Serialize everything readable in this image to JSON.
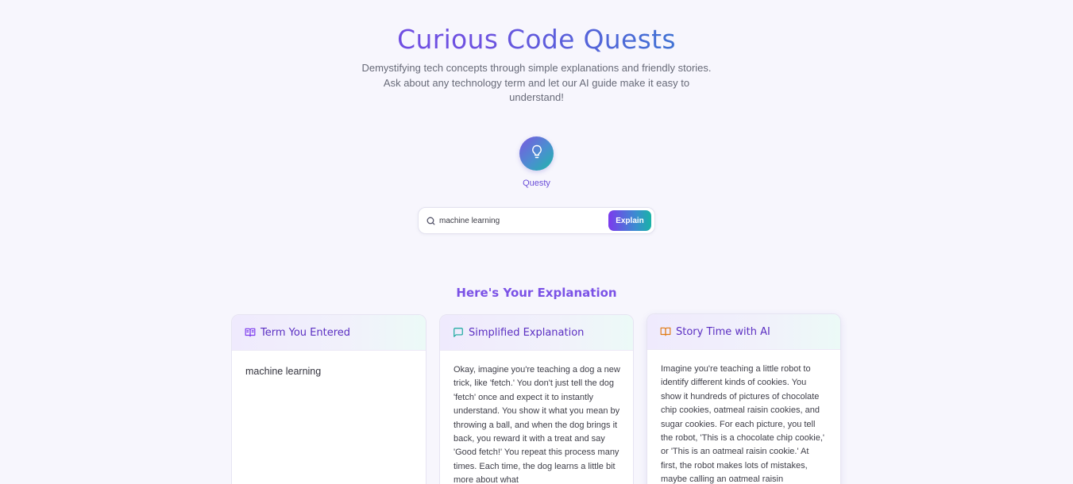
{
  "header": {
    "title": "Curious Code Quests",
    "subtitle": "Demystifying tech concepts through simple explanations and friendly stories. Ask about any technology term and let our AI guide make it easy to understand!"
  },
  "assistant": {
    "name": "Questy",
    "icon": "lightbulb-icon"
  },
  "search": {
    "value": "machine learning",
    "placeholder": "",
    "button_label": "Explain"
  },
  "results": {
    "heading": "Here's Your Explanation",
    "cards": [
      {
        "title": "Term You Entered",
        "icon": "book-open-icon",
        "text": "machine learning"
      },
      {
        "title": "Simplified Explanation",
        "icon": "message-square-icon",
        "text": "Okay, imagine you're teaching a dog a new trick, like 'fetch.' You don't just tell the dog 'fetch' once and expect it to instantly understand. You show it what you mean by throwing a ball, and when the dog brings it back, you reward it with a treat and say 'Good fetch!' You repeat this process many times. Each time, the dog learns a little bit more about what"
      },
      {
        "title": "Story Time with AI",
        "icon": "book-icon",
        "text": "Imagine you're teaching a little robot to identify different kinds of cookies. You show it hundreds of pictures of chocolate chip cookies, oatmeal raisin cookies, and sugar cookies. For each picture, you tell the robot, 'This is a chocolate chip cookie,' or 'This is an oatmeal raisin cookie.' At first, the robot makes lots of mistakes, maybe calling an oatmeal raisin"
      }
    ]
  },
  "colors": {
    "brand_purple": "#7c3aed",
    "brand_teal": "#19b3a6",
    "background": "#f7f6fd"
  }
}
